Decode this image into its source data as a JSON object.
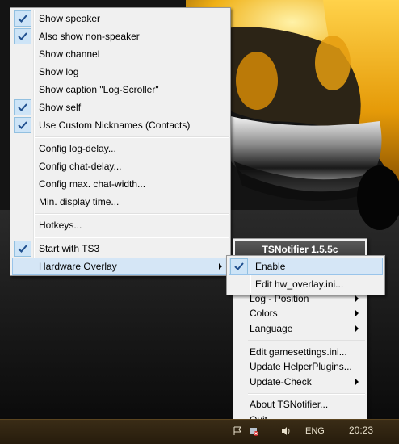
{
  "main_menu": {
    "items": [
      {
        "label": "Show speaker",
        "checked": true
      },
      {
        "label": "Also show non-speaker",
        "checked": true
      },
      {
        "label": "Show channel",
        "checked": false
      },
      {
        "label": "Show log",
        "checked": false
      },
      {
        "label": "Show caption \"Log-Scroller\"",
        "checked": false
      },
      {
        "label": "Show self",
        "checked": true
      },
      {
        "label": "Use Custom Nicknames (Contacts)",
        "checked": true
      },
      {
        "label": "Config log-delay...",
        "checked": false
      },
      {
        "label": "Config chat-delay...",
        "checked": false
      },
      {
        "label": "Config max. chat-width...",
        "checked": false
      },
      {
        "label": "Min. display time...",
        "checked": false
      },
      {
        "label": "Hotkeys...",
        "checked": false
      },
      {
        "label": "Start with TS3",
        "checked": true
      },
      {
        "label": "Hardware Overlay",
        "checked": false,
        "submenu": true,
        "highlighted": true
      }
    ]
  },
  "submenu": {
    "items": [
      {
        "label": "Enable",
        "checked": true,
        "highlighted": true
      },
      {
        "label": "Edit hw_overlay.ini...",
        "checked": false
      }
    ]
  },
  "tray_menu": {
    "title": "TSNotifier 1.5.5c",
    "items": [
      {
        "label": "Log - Position",
        "submenu": true
      },
      {
        "label": "Colors",
        "submenu": true
      },
      {
        "label": "Language",
        "submenu": true
      },
      {
        "label": "Edit gamesettings.ini..."
      },
      {
        "label": "Update HelperPlugins..."
      },
      {
        "label": "Update-Check",
        "submenu": true
      },
      {
        "label": "About TSNotifier..."
      },
      {
        "label": "Quit"
      }
    ]
  },
  "taskbar": {
    "language": "ENG",
    "clock": "20:23"
  },
  "colors": {
    "highlight": "#d5e6f6",
    "highlight_border": "#99c4ea",
    "check_bg": "#cde4f7",
    "menu_bg": "#f0f0f0"
  },
  "icons": [
    "checkmark-icon",
    "submenu-arrow-icon",
    "network-icon",
    "volume-icon",
    "flag-icon"
  ]
}
